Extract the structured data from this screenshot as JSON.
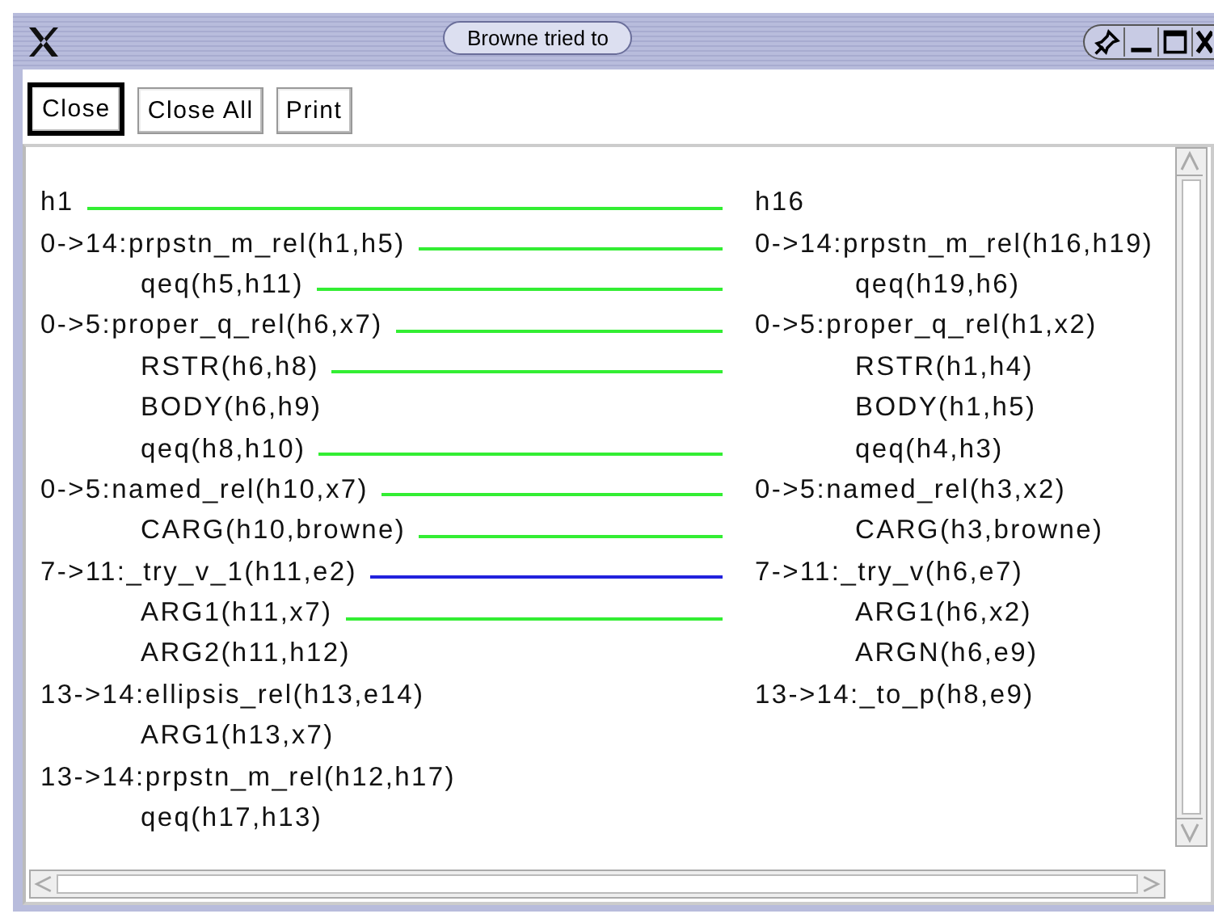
{
  "window": {
    "title": "Browne tried to"
  },
  "buttons": [
    {
      "label": "Close",
      "selected": true
    },
    {
      "label": "Close All",
      "selected": false
    },
    {
      "label": "Print",
      "selected": false
    }
  ],
  "left": [
    {
      "text": "h1",
      "color": "#33ee33"
    },
    {
      "text": "0->14:prpstn_m_rel(h1,h5)",
      "color": "#33ee33",
      "children": [
        {
          "text": "qeq(h5,h11)",
          "color": "#33ee33"
        }
      ]
    },
    {
      "text": "0->5:proper_q_rel(h6,x7)",
      "color": "#33ee33",
      "children": [
        {
          "text": "RSTR(h6,h8)",
          "color": "#33ee33"
        },
        {
          "text": "BODY(h6,h9)"
        },
        {
          "text": "qeq(h8,h10)",
          "color": "#33ee33"
        }
      ]
    },
    {
      "text": "0->5:named_rel(h10,x7)",
      "color": "#33ee33",
      "children": [
        {
          "text": "CARG(h10,browne)",
          "color": "#33ee33"
        }
      ]
    },
    {
      "text": "7->11:_try_v_1(h11,e2)",
      "color": "#2222dd",
      "children": [
        {
          "text": "ARG1(h11,x7)",
          "color": "#33ee33"
        },
        {
          "text": "ARG2(h11,h12)"
        }
      ]
    },
    {
      "text": "13->14:ellipsis_rel(h13,e14)",
      "children": [
        {
          "text": "ARG1(h13,x7)"
        }
      ]
    },
    {
      "text": "13->14:prpstn_m_rel(h12,h17)",
      "children": [
        {
          "text": "qeq(h17,h13)"
        }
      ]
    }
  ],
  "right": [
    {
      "text": "h16"
    },
    {
      "text": "0->14:prpstn_m_rel(h16,h19)",
      "children": [
        {
          "text": "qeq(h19,h6)"
        }
      ]
    },
    {
      "text": "0->5:proper_q_rel(h1,x2)",
      "children": [
        {
          "text": "RSTR(h1,h4)"
        },
        {
          "text": "BODY(h1,h5)"
        },
        {
          "text": "qeq(h4,h3)"
        }
      ]
    },
    {
      "text": "0->5:named_rel(h3,x2)",
      "children": [
        {
          "text": "CARG(h3,browne)"
        }
      ]
    },
    {
      "text": "7->11:_try_v(h6,e7)",
      "children": [
        {
          "text": "ARG1(h6,x2)"
        },
        {
          "text": "ARGN(h6,e9)"
        }
      ]
    },
    {
      "text": "13->14:_to_p(h8,e9)"
    }
  ]
}
